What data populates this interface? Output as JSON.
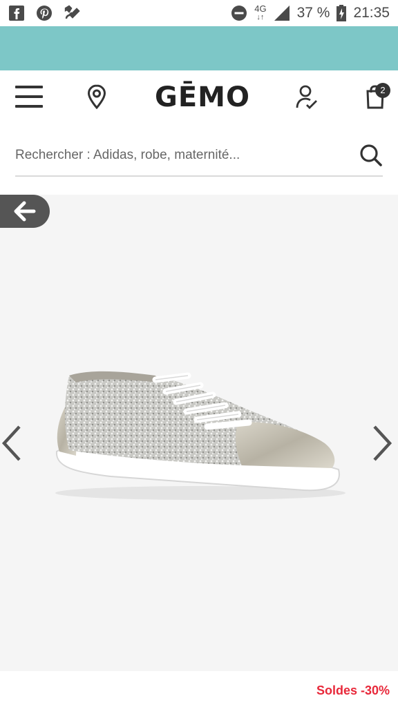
{
  "status_bar": {
    "network": "4G",
    "battery": "37 %",
    "time": "21:35"
  },
  "colors": {
    "banner": "#7dc7c7",
    "promo": "#e8283a",
    "dark": "#333333"
  },
  "header": {
    "logo": "GĒMO",
    "cart_count": "2"
  },
  "search": {
    "placeholder": "Rechercher : Adidas, robe, maternité..."
  },
  "product": {
    "promo": "Soldes -30%"
  }
}
